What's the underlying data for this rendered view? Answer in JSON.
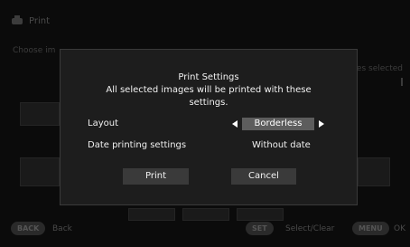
{
  "background": {
    "title": "Print",
    "instruction": "Choose im",
    "selected_text": "es selected",
    "footer": {
      "back_key": "BACK",
      "back_label": "Back",
      "set_key": "SET",
      "set_label": "Select/Clear",
      "menu_key": "MENU",
      "menu_label": "OK"
    }
  },
  "dialog": {
    "title": "Print Settings",
    "description": "All selected images will be printed with these settings.",
    "layout": {
      "label": "Layout",
      "value": "Borderless"
    },
    "date_printing": {
      "label": "Date printing settings",
      "value": "Without date"
    },
    "buttons": {
      "print": "Print",
      "cancel": "Cancel"
    }
  },
  "colors": {
    "dialog_bg": "#1d1d1d",
    "highlight": "#5d5d5d",
    "button": "#3a3a3a"
  }
}
